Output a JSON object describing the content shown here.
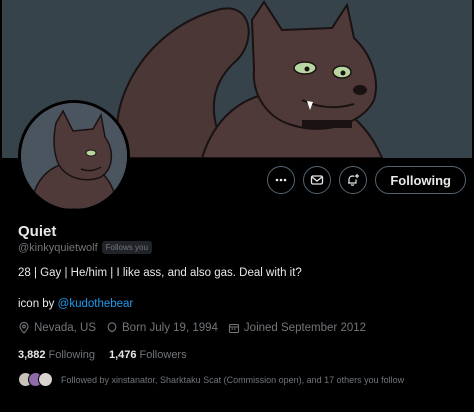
{
  "profile": {
    "display_name": "Quiet",
    "handle": "@kinkyquietwolf",
    "follows_you_badge": "Follows you",
    "bio": "28 | Gay | He/him | I like ass, and also gas. Deal with it?",
    "icon_credit_prefix": "icon by ",
    "icon_credit_link": "@kudothebear",
    "location": "Nevada, US",
    "birthday": "Born July 19, 1994",
    "joined": "Joined September 2012"
  },
  "stats": {
    "following_count": "3,882",
    "following_label": "Following",
    "followers_count": "1,476",
    "followers_label": "Followers"
  },
  "followed_by_text": "Followed by xinstanator, Sharktaku Scat (Commission open), and 17 others you follow",
  "actions": {
    "more_icon": "more-icon",
    "message_icon": "envelope-icon",
    "notify_icon": "bell-plus-icon",
    "follow_label": "Following"
  },
  "colors": {
    "background": "#000000",
    "banner_bg": "#37434a",
    "link": "#1d9bf0",
    "muted_text": "#71767b"
  }
}
